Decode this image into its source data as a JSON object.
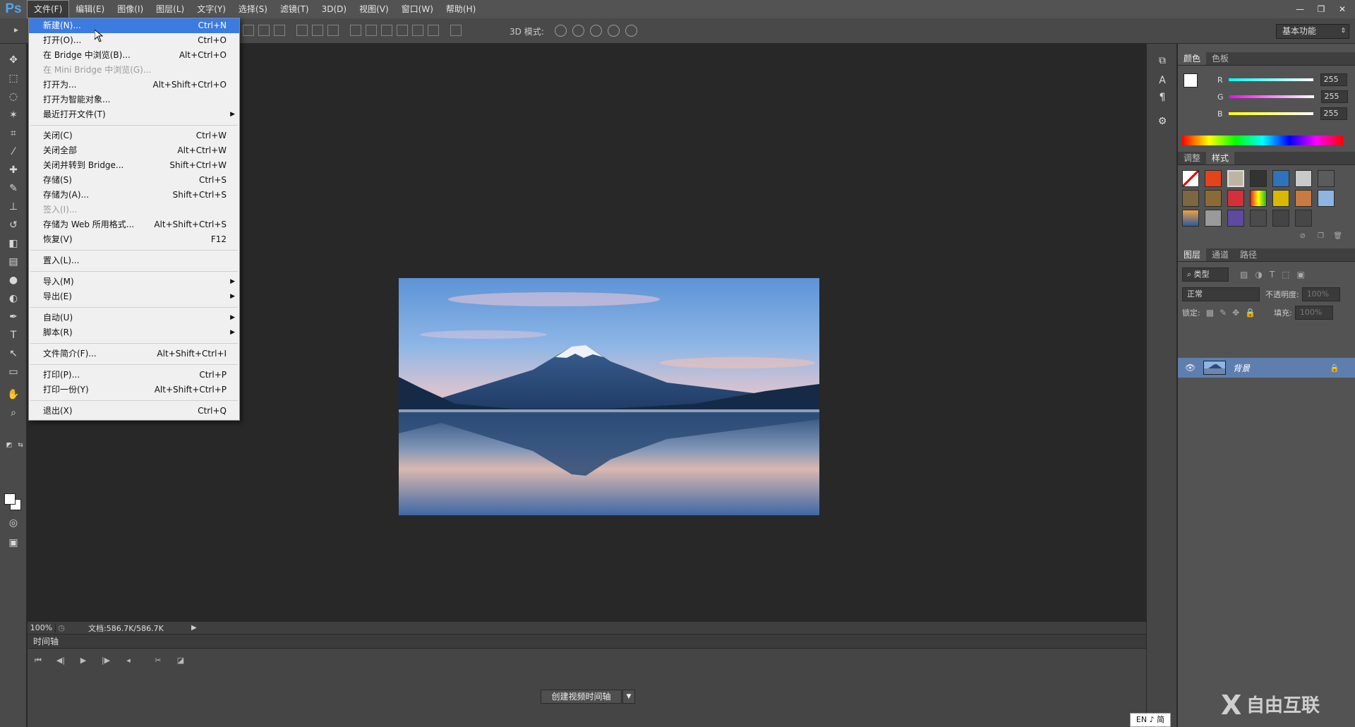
{
  "app": {
    "logo": "Ps",
    "workspace": "基本功能"
  },
  "menubar": {
    "items": [
      "文件(F)",
      "编辑(E)",
      "图像(I)",
      "图层(L)",
      "文字(Y)",
      "选择(S)",
      "滤镜(T)",
      "3D(D)",
      "视图(V)",
      "窗口(W)",
      "帮助(H)"
    ],
    "active_index": 0
  },
  "optbar": {
    "mode_label": "3D 模式:"
  },
  "file_menu": {
    "groups": [
      [
        {
          "label": "新建(N)...",
          "shortcut": "Ctrl+N",
          "highlighted": true
        },
        {
          "label": "打开(O)...",
          "shortcut": "Ctrl+O"
        },
        {
          "label": "在 Bridge 中浏览(B)...",
          "shortcut": "Alt+Ctrl+O"
        },
        {
          "label": "在 Mini Bridge 中浏览(G)...",
          "shortcut": "",
          "disabled": true
        },
        {
          "label": "打开为...",
          "shortcut": "Alt+Shift+Ctrl+O"
        },
        {
          "label": "打开为智能对象...",
          "shortcut": ""
        },
        {
          "label": "最近打开文件(T)",
          "shortcut": "",
          "submenu": true
        }
      ],
      [
        {
          "label": "关闭(C)",
          "shortcut": "Ctrl+W"
        },
        {
          "label": "关闭全部",
          "shortcut": "Alt+Ctrl+W"
        },
        {
          "label": "关闭并转到 Bridge...",
          "shortcut": "Shift+Ctrl+W"
        },
        {
          "label": "存储(S)",
          "shortcut": "Ctrl+S"
        },
        {
          "label": "存储为(A)...",
          "shortcut": "Shift+Ctrl+S"
        },
        {
          "label": "签入(I)...",
          "shortcut": "",
          "disabled": true
        },
        {
          "label": "存储为 Web 所用格式...",
          "shortcut": "Alt+Shift+Ctrl+S"
        },
        {
          "label": "恢复(V)",
          "shortcut": "F12"
        }
      ],
      [
        {
          "label": "置入(L)...",
          "shortcut": ""
        }
      ],
      [
        {
          "label": "导入(M)",
          "shortcut": "",
          "submenu": true
        },
        {
          "label": "导出(E)",
          "shortcut": "",
          "submenu": true
        }
      ],
      [
        {
          "label": "自动(U)",
          "shortcut": "",
          "submenu": true
        },
        {
          "label": "脚本(R)",
          "shortcut": "",
          "submenu": true
        }
      ],
      [
        {
          "label": "文件简介(F)...",
          "shortcut": "Alt+Shift+Ctrl+I"
        }
      ],
      [
        {
          "label": "打印(P)...",
          "shortcut": "Ctrl+P"
        },
        {
          "label": "打印一份(Y)",
          "shortcut": "Alt+Shift+Ctrl+P"
        }
      ],
      [
        {
          "label": "退出(X)",
          "shortcut": "Ctrl+Q"
        }
      ]
    ]
  },
  "status": {
    "zoom": "100%",
    "doc_info": "文档:586.7K/586.7K"
  },
  "timeline": {
    "title": "时间轴",
    "create_button": "创建视频时间轴"
  },
  "color_panel": {
    "tabs": [
      "颜色",
      "色板"
    ],
    "r_label": "R",
    "g_label": "G",
    "b_label": "B",
    "r": "255",
    "g": "255",
    "b": "255"
  },
  "styles_panel": {
    "tabs": [
      "调整",
      "样式"
    ]
  },
  "layers_panel": {
    "tabs": [
      "图层",
      "通道",
      "路径"
    ],
    "filter_label": "类型",
    "blend_mode": "正常",
    "opacity_label": "不透明度:",
    "opacity": "100%",
    "lock_label": "锁定:",
    "fill_label": "填充:",
    "fill": "100%",
    "layer_name": "背景"
  },
  "ime": {
    "label": "EN ♪ 简"
  },
  "watermark": {
    "text": "自由互联"
  }
}
